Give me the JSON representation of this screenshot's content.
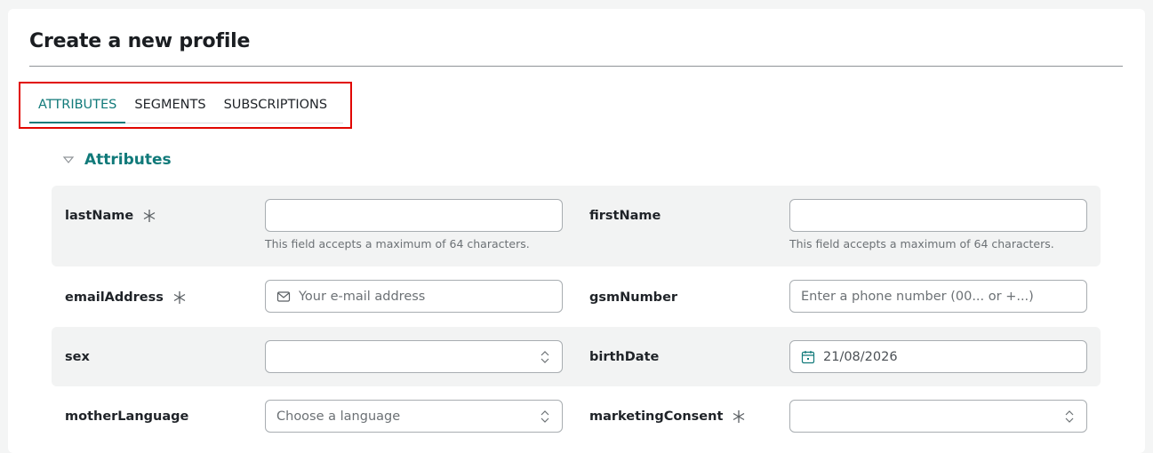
{
  "page": {
    "title": "Create a new profile"
  },
  "tabs": [
    {
      "label": "ATTRIBUTES",
      "active": true
    },
    {
      "label": "SEGMENTS",
      "active": false
    },
    {
      "label": "SUBSCRIPTIONS",
      "active": false
    }
  ],
  "section": {
    "title": "Attributes",
    "caret_icon": "chevron-down-icon"
  },
  "colors": {
    "accent": "#117a7a",
    "highlight_border": "#e10600",
    "row_shade": "#f2f3f3"
  },
  "fields": {
    "lastName": {
      "label": "lastName",
      "required": true,
      "value": "",
      "hint": "This field accepts a maximum of 64 characters."
    },
    "firstName": {
      "label": "firstName",
      "required": false,
      "value": "",
      "hint": "This field accepts a maximum of 64 characters."
    },
    "emailAddress": {
      "label": "emailAddress",
      "required": true,
      "placeholder": "Your e-mail address",
      "icon": "mail-icon"
    },
    "gsmNumber": {
      "label": "gsmNumber",
      "required": false,
      "placeholder": "Enter a phone number (00... or +...)"
    },
    "sex": {
      "label": "sex",
      "required": false,
      "value": ""
    },
    "birthDate": {
      "label": "birthDate",
      "required": false,
      "value": "21/08/2026",
      "icon": "calendar-icon"
    },
    "motherLanguage": {
      "label": "motherLanguage",
      "required": false,
      "placeholder": "Choose a language"
    },
    "marketingConsent": {
      "label": "marketingConsent",
      "required": true,
      "value": ""
    }
  }
}
